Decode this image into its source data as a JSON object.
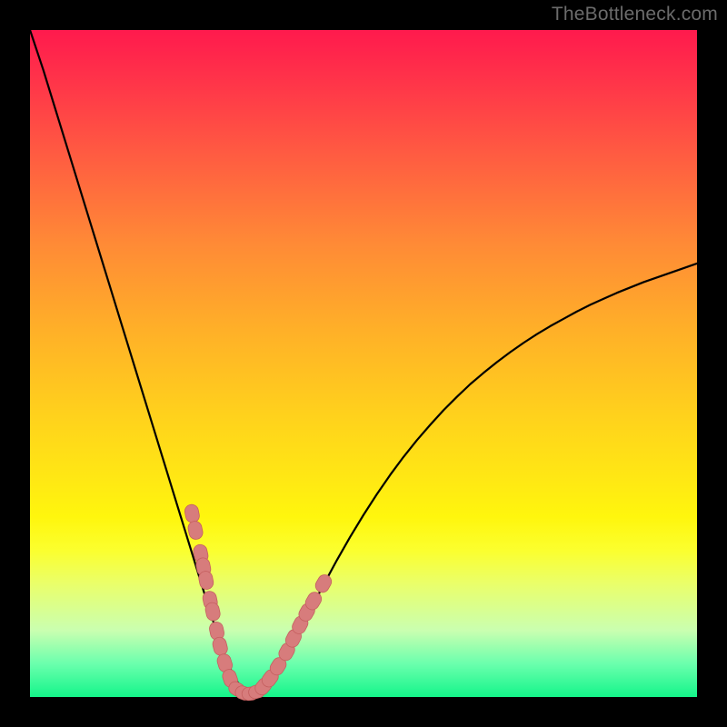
{
  "watermark": "TheBottleneck.com",
  "colors": {
    "frame": "#000000",
    "curve": "#000000",
    "marker_fill": "#d77c7c",
    "marker_stroke": "#c55f5f",
    "gradient_stops": [
      "#ff1a4d",
      "#ff5942",
      "#ffb028",
      "#ffe714",
      "#fbff2e",
      "#caffb0",
      "#14f58a"
    ]
  },
  "chart_data": {
    "type": "line",
    "title": "",
    "xlabel": "",
    "ylabel": "",
    "xlim": [
      0,
      100
    ],
    "ylim": [
      0,
      100
    ],
    "x": [
      0,
      2,
      4,
      6,
      8,
      10,
      12,
      14,
      16,
      18,
      20,
      22,
      24,
      26,
      27,
      28,
      29,
      30,
      31,
      32,
      33,
      34,
      36,
      38,
      40,
      42,
      44,
      46,
      48,
      50,
      52,
      54,
      56,
      58,
      60,
      62,
      64,
      66,
      68,
      70,
      72,
      74,
      76,
      78,
      80,
      82,
      84,
      86,
      88,
      90,
      92,
      94,
      96,
      98,
      100
    ],
    "y": [
      100,
      94,
      87.5,
      81,
      74.5,
      68,
      61.5,
      55,
      48.5,
      42,
      35.5,
      29,
      22.5,
      16,
      12.8,
      9.7,
      6.8,
      4.3,
      2.4,
      1.1,
      0.4,
      0.6,
      2.3,
      5.4,
      9.1,
      13.0,
      16.8,
      20.5,
      24.0,
      27.3,
      30.4,
      33.3,
      36.0,
      38.5,
      40.8,
      43.0,
      45.0,
      46.9,
      48.6,
      50.2,
      51.7,
      53.1,
      54.4,
      55.6,
      56.7,
      57.8,
      58.8,
      59.7,
      60.6,
      61.4,
      62.2,
      62.9,
      63.6,
      64.3,
      65.0
    ],
    "markers": {
      "left_cluster_x": [
        24.3,
        24.8,
        25.6,
        26.0,
        26.4,
        27.0,
        27.4,
        28.0,
        28.5,
        29.2,
        30.0
      ],
      "left_cluster_y": [
        27.5,
        25.0,
        21.5,
        19.5,
        17.5,
        14.5,
        12.8,
        9.9,
        7.6,
        5.1,
        2.8
      ],
      "bottom_cluster_x": [
        31.0,
        32.0,
        33.0,
        34.0
      ],
      "bottom_cluster_y": [
        1.2,
        0.6,
        0.5,
        0.8
      ],
      "right_cluster_x": [
        35.0,
        36.0,
        37.2,
        38.5,
        39.5,
        40.5,
        41.5,
        42.5,
        44.0
      ],
      "right_cluster_y": [
        1.6,
        2.8,
        4.6,
        6.8,
        8.8,
        10.8,
        12.7,
        14.4,
        17.0
      ]
    }
  }
}
